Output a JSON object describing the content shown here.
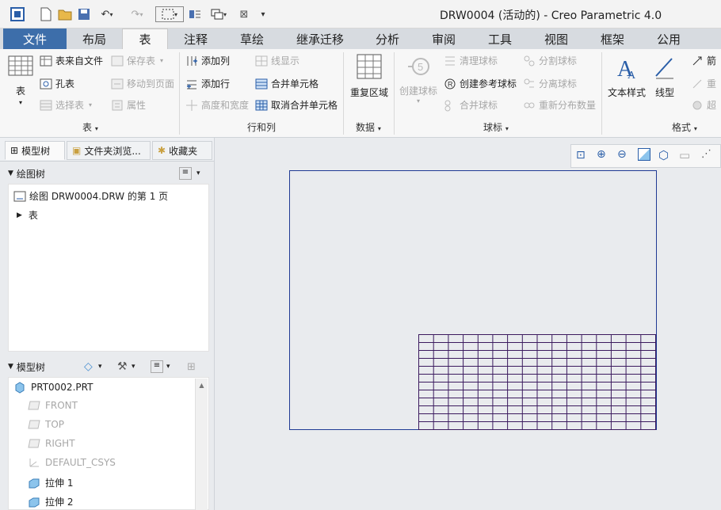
{
  "window": {
    "title": "DRW0004 (活动的) - Creo Parametric 4.0"
  },
  "tabs": [
    {
      "label": "文件"
    },
    {
      "label": "布局"
    },
    {
      "label": "表"
    },
    {
      "label": "注释"
    },
    {
      "label": "草绘"
    },
    {
      "label": "继承迁移"
    },
    {
      "label": "分析"
    },
    {
      "label": "审阅"
    },
    {
      "label": "工具"
    },
    {
      "label": "视图"
    },
    {
      "label": "框架"
    },
    {
      "label": "公用"
    }
  ],
  "ribbon": {
    "table_group": {
      "label": "表",
      "table_button": "表",
      "from_file": "表来自文件",
      "save_table": "保存表",
      "hole_table": "孔表",
      "move_to_page": "移动到页面",
      "select_table": "选择表",
      "properties": "属性"
    },
    "rowcol_group": {
      "label": "行和列",
      "add_column": "添加列",
      "line_display": "线显示",
      "add_row": "添加行",
      "merge_cells": "合并单元格",
      "height_width": "高度和宽度",
      "unmerge_cells": "取消合并单元格"
    },
    "data_group": {
      "label": "数据",
      "repeat_region": "重复区域"
    },
    "balloon_group": {
      "label": "球标",
      "create_balloon": "创建球标",
      "clean_balloons": "清理球标",
      "create_ref_balloon": "创建参考球标",
      "merge_balloons": "合并球标",
      "split_balloons": "分割球标",
      "detach_balloons": "分离球标",
      "redistribute_qty": "重新分布数量"
    },
    "format_group": {
      "label": "格式",
      "text_style": "文本样式",
      "line_style": "线型",
      "arrow": "箭",
      "repeat": "重",
      "super": "超"
    }
  },
  "left_panel": {
    "tabs": [
      {
        "label": "模型树"
      },
      {
        "label": "文件夹浏览..."
      },
      {
        "label": "收藏夹"
      }
    ],
    "drawing_tree": {
      "header": "绘图树",
      "items": [
        {
          "label": "绘图 DRW0004.DRW 的第 1 页"
        },
        {
          "label": "表"
        }
      ]
    },
    "model_tree": {
      "header": "模型树",
      "items": [
        {
          "label": "PRT0002.PRT",
          "enabled": true,
          "icon": "part-icon"
        },
        {
          "label": "FRONT",
          "enabled": false,
          "icon": "datum-plane-icon"
        },
        {
          "label": "TOP",
          "enabled": false,
          "icon": "datum-plane-icon"
        },
        {
          "label": "RIGHT",
          "enabled": false,
          "icon": "datum-plane-icon"
        },
        {
          "label": "DEFAULT_CSYS",
          "enabled": false,
          "icon": "csys-icon"
        },
        {
          "label": "拉伸 1",
          "enabled": true,
          "icon": "extrude-icon"
        },
        {
          "label": "拉伸 2",
          "enabled": true,
          "icon": "extrude-icon"
        }
      ]
    }
  },
  "drawing_table": {
    "rows": 12,
    "cols": 16
  },
  "colors": {
    "accent": "#3d6eaa",
    "sheet_border": "#1f3a94",
    "table_line": "#3b1a5e"
  }
}
